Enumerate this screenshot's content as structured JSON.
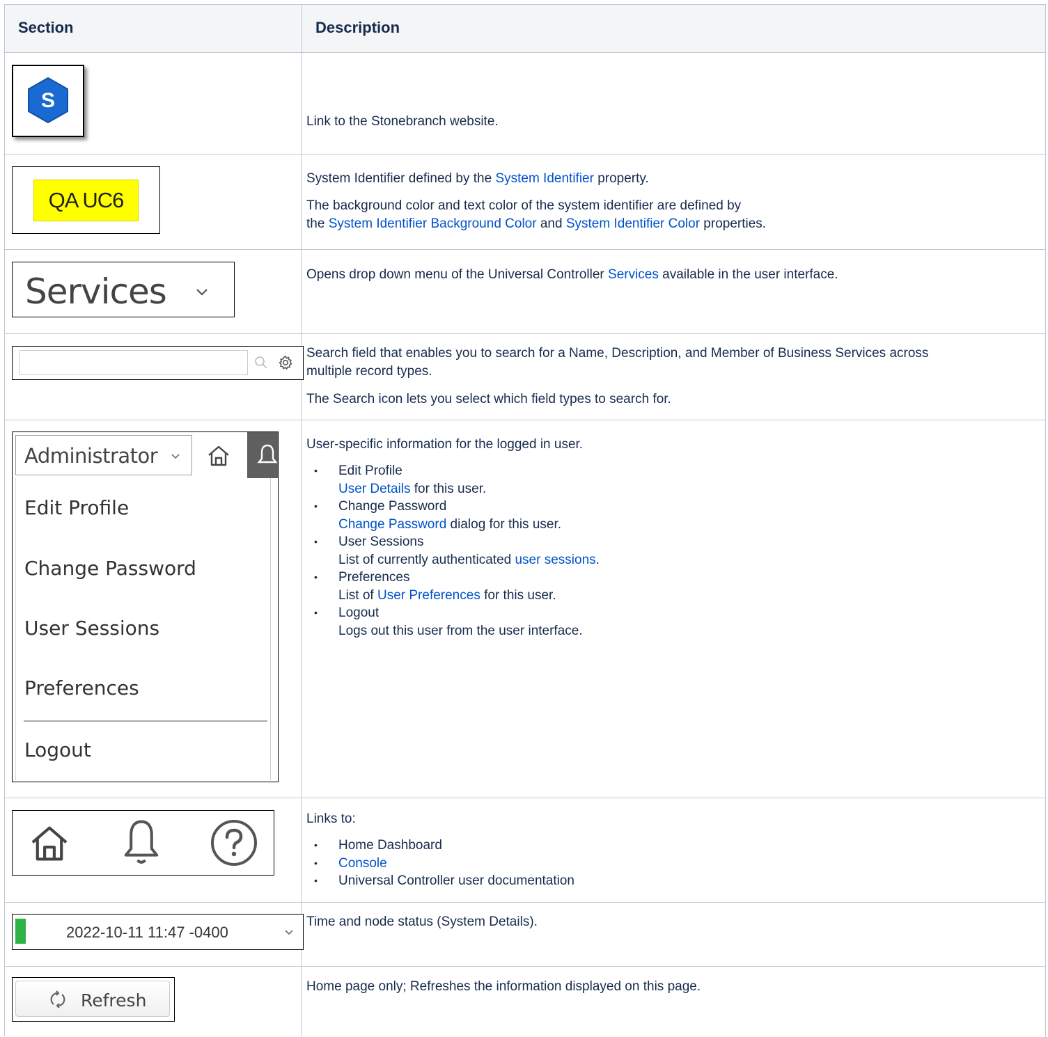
{
  "header": {
    "section": "Section",
    "description": "Description"
  },
  "rows": {
    "logo": {
      "icon": "stonebranch-hexagon-logo",
      "letter": "S",
      "text": "Link to the Stonebranch website."
    },
    "identifier": {
      "badge": "QA UC6",
      "badge_bg": "#ffff00",
      "p1_pre": "System Identifier defined by the ",
      "p1_link": "System Identifier",
      "p1_post": " property.",
      "p2_pre": "The background color and text color of the system identifier are defined by",
      "p2_pre2": "the ",
      "p2_link1": "System Identifier Background Color",
      "p2_mid": " and ",
      "p2_link2": "System Identifier Color",
      "p2_post": " properties."
    },
    "services": {
      "label": "Services",
      "chevron": "chevron-down-icon",
      "text_pre": "Opens drop down menu of the Universal Controller ",
      "text_link": "Services",
      "text_post": " available in the user interface."
    },
    "search": {
      "search_icon": "search-icon",
      "settings_icon": "gear-icon",
      "p1_line1": "Search field that enables you to search for a Name, Description, and Member of Business Services across",
      "p1_line2": "multiple record types.",
      "p2": "The Search icon lets you select which field types to search for."
    },
    "user": {
      "dropdown_label": "Administrator",
      "menu": [
        "Edit Profile",
        "Change Password",
        "User Sessions",
        "Preferences",
        "Logout"
      ],
      "intro": "User-specific information for the logged in user.",
      "items": [
        {
          "title": "Edit Profile",
          "link": "User Details",
          "post": " for this user.",
          "pre": ""
        },
        {
          "title": "Change Password",
          "link": "Change Password",
          "post": " dialog for this user.",
          "pre": ""
        },
        {
          "title": "User Sessions",
          "pre": "List of currently authenticated ",
          "link": "user sessions",
          "post": "."
        },
        {
          "title": "Preferences",
          "pre": "List of ",
          "link": "User Preferences",
          "post": " for this user."
        },
        {
          "title": "Logout",
          "pre": "Logs out this user from the user interface.",
          "link": "",
          "post": ""
        }
      ]
    },
    "links": {
      "icons": [
        "home-icon",
        "bell-icon",
        "help-icon"
      ],
      "intro": "Links to:",
      "item1": "Home Dashboard",
      "item2": "Console",
      "item3": "Universal Controller user documentation"
    },
    "time": {
      "timestamp": "2022-10-11 11:47 -0400",
      "status_color": "#2fb344",
      "text": "Time and node status (System Details)."
    },
    "refresh": {
      "label": "Refresh",
      "icon": "refresh-icon",
      "text": "Home page only; Refreshes the information displayed on this page."
    }
  }
}
